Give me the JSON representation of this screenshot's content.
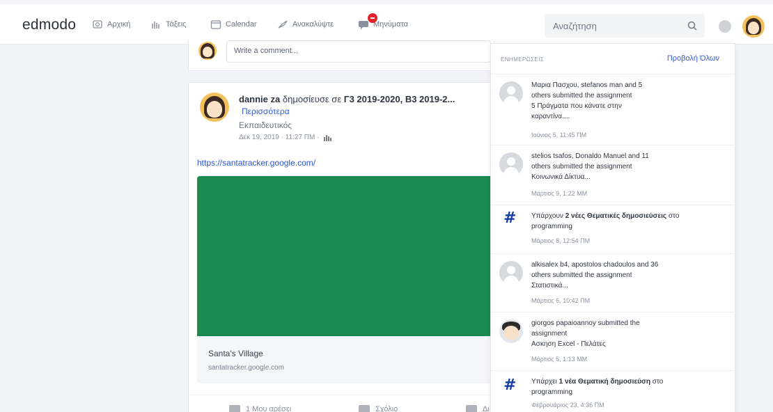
{
  "nav": {
    "brand": "edmodo",
    "items": [
      {
        "label": "Αρχική",
        "icon": "home-icon"
      },
      {
        "label": "Τάξεις",
        "icon": "classes-icon"
      },
      {
        "label": "Calendar",
        "icon": "calendar-icon"
      },
      {
        "label": "Ανακαλύψτε",
        "icon": "discover-icon"
      },
      {
        "label": "Μηνύματα",
        "icon": "messages-icon"
      }
    ],
    "search_placeholder": "Αναζήτηση"
  },
  "comment": {
    "placeholder": "Write a comment..."
  },
  "post": {
    "author": "dannie za",
    "verb": "δημοσίευσε σε",
    "groups": "Γ3 2019-2020, Β3 2019-2...",
    "more": "Περισσότερα",
    "role": "Εκπαιδευτικός",
    "date": "Δεκ 19, 2019 · 11:27 ΠΜ ·",
    "link": "https://santatracker.google.com/",
    "preview_title": "Santa's Village",
    "preview_url": "santatracker.google.com",
    "actions": {
      "like": "1 Μου αρέσει",
      "reply": "Σχόλιο",
      "share": "Δι"
    }
  },
  "notifications": {
    "header": "ΕΝΗΜΕΡΩΣΕΙΣ",
    "view_all": "Προβολή Όλων",
    "items": [
      {
        "l1": "Μαρια Πασχου, stefanos man and 5",
        "l2": "others submitted the assignment",
        "l3": "5 Πράγματα που κάνατε στην",
        "l4": "καραντίνα....",
        "time": "Ιούνιος 5, 11:45 ΠΜ"
      },
      {
        "l1": "stelios tsafos, Donaldo Manuel and 11",
        "l2": "others submitted the assignment",
        "l3": "Κοινωνικά Δίκτυα...",
        "time": "Μάρτιος 9, 1:22 ΜΜ"
      },
      {
        "pre": "Υπάρχουν ",
        "bold": "2 νέες Θεματικές δημοσιεύσεις",
        "post": " στο",
        "l2": "programming",
        "time": "Μάρτιος 8, 12:54 ΠΜ"
      },
      {
        "l1": "alkisalex b4, apostolos chadoulos and 36",
        "l2": "others submitted the assignment",
        "l3": "Στατιστικά...",
        "time": "Μάρτιος 6, 10:42 ΠΜ"
      },
      {
        "l1": "giorgos papaioannoy submitted the",
        "l2": "assignment",
        "l3": "Ασκηση Excel - Πελάτες",
        "time": "Μάρτιος 5, 1:13 ΜΜ"
      },
      {
        "pre": "Υπάρχει ",
        "bold": "1 νέα Θεματική δημοσιεύση",
        "post": " στο",
        "l2": "programming",
        "time": "Φεβρουάριος 23, 4:36 ΠΜ"
      }
    ]
  },
  "colors": {
    "accent": "#2f5bd8",
    "preview": "#1b8a4f",
    "badge": "#e3232c",
    "hash": "#1d3ca8"
  }
}
